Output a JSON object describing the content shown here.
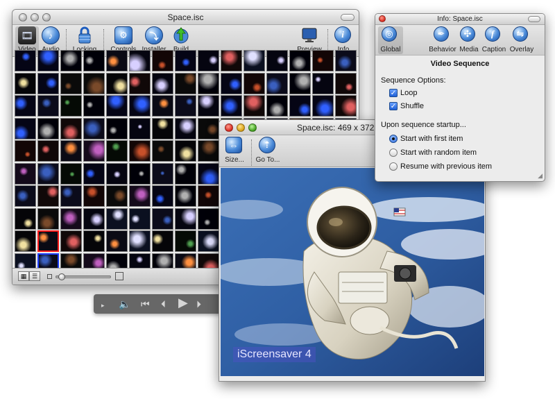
{
  "library_window": {
    "title": "Space.isc",
    "toolbar": {
      "video": "Video",
      "audio": "Audio",
      "locking": "Locking",
      "controls": "Controls",
      "installer": "Installer",
      "build": "Build",
      "preview": "Preview",
      "info": "Info"
    },
    "grid_rows": 10,
    "grid_cols": 15,
    "selected_items": [
      "red-frame item row 9 col 2",
      "blue-frame item row 10 col 2"
    ]
  },
  "preview_window": {
    "title": "Space.isc: 469 x 372",
    "toolbar": {
      "size": "Size...",
      "goto": "Go To..."
    },
    "watermark": "iScreensaver 4"
  },
  "info_window": {
    "title": "Info: Space.isc",
    "tabs": {
      "global": "Global",
      "behavior": "Behavior",
      "media": "Media",
      "caption": "Caption",
      "overlay": "Overlay"
    },
    "section_title": "Video Sequence",
    "sequence_options_label": "Sequence Options:",
    "loop": "Loop",
    "shuffle": "Shuffle",
    "startup_label": "Upon sequence startup...",
    "start_first": "Start with first item",
    "start_random": "Start with random item",
    "resume_previous": "Resume with previous item"
  },
  "hud": {
    "colors": {
      "bg": "#4a4a4a",
      "fg": "#d6d6d6"
    }
  },
  "colors": {
    "accent_blue": "#2a6ae0",
    "selection_red": "#ff1a1a",
    "selection_blue": "#1b3dff"
  }
}
